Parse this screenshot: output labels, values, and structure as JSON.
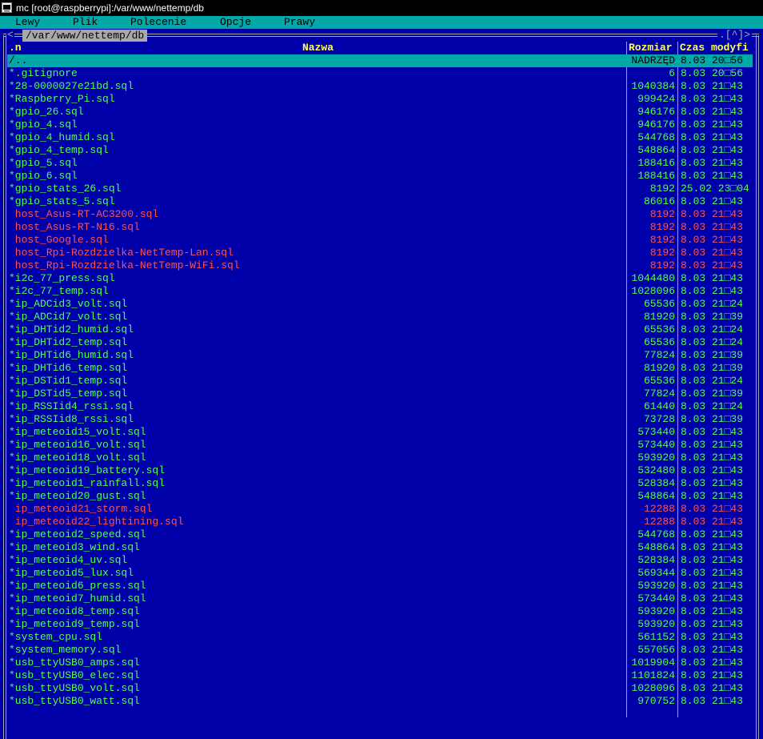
{
  "window": {
    "title": "mc [root@raspberrypi]:/var/www/nettemp/db",
    "icon": "terminal-icon"
  },
  "menu": [
    "Lewy",
    "Plik",
    "Polecenie",
    "Opcje",
    "Prawy"
  ],
  "panel": {
    "path": "/var/www/nettemp/db",
    "left_arrow": "<",
    "right_controls": ".[^]>",
    "headers": {
      "sort": ".n",
      "name": "Nazwa",
      "size": "Rozmiar",
      "time": "Czas modyfi"
    }
  },
  "colors": {
    "background": "#0000a8",
    "executable": "#54fc54",
    "link": "#fc5454",
    "header": "#ffff54",
    "selection": "#00a8a8"
  },
  "files": [
    {
      "name": "/..",
      "size": "NADRZĘD",
      "time": "8.03 20□56",
      "kind": "dir",
      "selected": true
    },
    {
      "name": "*.gitignore",
      "size": "6",
      "time": "8.03 20□56",
      "kind": "exec"
    },
    {
      "name": "*28-0000027e21bd.sql",
      "size": "1040384",
      "time": "8.03 21□43",
      "kind": "exec"
    },
    {
      "name": "*Raspberry_Pi.sql",
      "size": "999424",
      "time": "8.03 21□43",
      "kind": "exec"
    },
    {
      "name": "*gpio_26.sql",
      "size": "946176",
      "time": "8.03 21□43",
      "kind": "exec"
    },
    {
      "name": "*gpio_4.sql",
      "size": "946176",
      "time": "8.03 21□43",
      "kind": "exec"
    },
    {
      "name": "*gpio_4_humid.sql",
      "size": "544768",
      "time": "8.03 21□43",
      "kind": "exec"
    },
    {
      "name": "*gpio_4_temp.sql",
      "size": "548864",
      "time": "8.03 21□43",
      "kind": "exec"
    },
    {
      "name": "*gpio_5.sql",
      "size": "188416",
      "time": "8.03 21□43",
      "kind": "exec"
    },
    {
      "name": "*gpio_6.sql",
      "size": "188416",
      "time": "8.03 21□43",
      "kind": "exec"
    },
    {
      "name": "*gpio_stats_26.sql",
      "size": "8192",
      "time": "25.02 23□04",
      "kind": "exec"
    },
    {
      "name": "*gpio_stats_5.sql",
      "size": "86016",
      "time": "8.03 21□43",
      "kind": "exec"
    },
    {
      "name": " host_Asus-RT-AC3200.sql",
      "size": "8192",
      "time": "8.03 21□43",
      "kind": "lnk"
    },
    {
      "name": " host_Asus-RT-N16.sql",
      "size": "8192",
      "time": "8.03 21□43",
      "kind": "lnk"
    },
    {
      "name": " host_Google.sql",
      "size": "8192",
      "time": "8.03 21□43",
      "kind": "lnk"
    },
    {
      "name": " host_Rpi-Rozdzielka-NetTemp-Lan.sql",
      "size": "8192",
      "time": "8.03 21□43",
      "kind": "lnk"
    },
    {
      "name": " host_Rpi-Rozdzielka-NetTemp-WiFi.sql",
      "size": "8192",
      "time": "8.03 21□43",
      "kind": "lnk"
    },
    {
      "name": "*i2c_77_press.sql",
      "size": "1044480",
      "time": "8.03 21□43",
      "kind": "exec"
    },
    {
      "name": "*i2c_77_temp.sql",
      "size": "1028096",
      "time": "8.03 21□43",
      "kind": "exec"
    },
    {
      "name": "*ip_ADCid3_volt.sql",
      "size": "65536",
      "time": "8.03 21□24",
      "kind": "exec"
    },
    {
      "name": "*ip_ADCid7_volt.sql",
      "size": "81920",
      "time": "8.03 21□39",
      "kind": "exec"
    },
    {
      "name": "*ip_DHTid2_humid.sql",
      "size": "65536",
      "time": "8.03 21□24",
      "kind": "exec"
    },
    {
      "name": "*ip_DHTid2_temp.sql",
      "size": "65536",
      "time": "8.03 21□24",
      "kind": "exec"
    },
    {
      "name": "*ip_DHTid6_humid.sql",
      "size": "77824",
      "time": "8.03 21□39",
      "kind": "exec"
    },
    {
      "name": "*ip_DHTid6_temp.sql",
      "size": "81920",
      "time": "8.03 21□39",
      "kind": "exec"
    },
    {
      "name": "*ip_DSTid1_temp.sql",
      "size": "65536",
      "time": "8.03 21□24",
      "kind": "exec"
    },
    {
      "name": "*ip_DSTid5_temp.sql",
      "size": "77824",
      "time": "8.03 21□39",
      "kind": "exec"
    },
    {
      "name": "*ip_RSSIid4_rssi.sql",
      "size": "61440",
      "time": "8.03 21□24",
      "kind": "exec"
    },
    {
      "name": "*ip_RSSIid8_rssi.sql",
      "size": "73728",
      "time": "8.03 21□39",
      "kind": "exec"
    },
    {
      "name": "*ip_meteoid15_volt.sql",
      "size": "573440",
      "time": "8.03 21□43",
      "kind": "exec"
    },
    {
      "name": "*ip_meteoid16_volt.sql",
      "size": "573440",
      "time": "8.03 21□43",
      "kind": "exec"
    },
    {
      "name": "*ip_meteoid18_volt.sql",
      "size": "593920",
      "time": "8.03 21□43",
      "kind": "exec"
    },
    {
      "name": "*ip_meteoid19_battery.sql",
      "size": "532480",
      "time": "8.03 21□43",
      "kind": "exec"
    },
    {
      "name": "*ip_meteoid1_rainfall.sql",
      "size": "528384",
      "time": "8.03 21□43",
      "kind": "exec"
    },
    {
      "name": "*ip_meteoid20_gust.sql",
      "size": "548864",
      "time": "8.03 21□43",
      "kind": "exec"
    },
    {
      "name": " ip_meteoid21_storm.sql",
      "size": "12288",
      "time": "8.03 21□43",
      "kind": "lnk"
    },
    {
      "name": " ip_meteoid22_lightining.sql",
      "size": "12288",
      "time": "8.03 21□43",
      "kind": "lnk"
    },
    {
      "name": "*ip_meteoid2_speed.sql",
      "size": "544768",
      "time": "8.03 21□43",
      "kind": "exec"
    },
    {
      "name": "*ip_meteoid3_wind.sql",
      "size": "548864",
      "time": "8.03 21□43",
      "kind": "exec"
    },
    {
      "name": "*ip_meteoid4_uv.sql",
      "size": "528384",
      "time": "8.03 21□43",
      "kind": "exec"
    },
    {
      "name": "*ip_meteoid5_lux.sql",
      "size": "569344",
      "time": "8.03 21□43",
      "kind": "exec"
    },
    {
      "name": "*ip_meteoid6_press.sql",
      "size": "593920",
      "time": "8.03 21□43",
      "kind": "exec"
    },
    {
      "name": "*ip_meteoid7_humid.sql",
      "size": "573440",
      "time": "8.03 21□43",
      "kind": "exec"
    },
    {
      "name": "*ip_meteoid8_temp.sql",
      "size": "593920",
      "time": "8.03 21□43",
      "kind": "exec"
    },
    {
      "name": "*ip_meteoid9_temp.sql",
      "size": "593920",
      "time": "8.03 21□43",
      "kind": "exec"
    },
    {
      "name": "*system_cpu.sql",
      "size": "561152",
      "time": "8.03 21□43",
      "kind": "exec"
    },
    {
      "name": "*system_memory.sql",
      "size": "557056",
      "time": "8.03 21□43",
      "kind": "exec"
    },
    {
      "name": "*usb_ttyUSB0_amps.sql",
      "size": "1019904",
      "time": "8.03 21□43",
      "kind": "exec"
    },
    {
      "name": "*usb_ttyUSB0_elec.sql",
      "size": "1101824",
      "time": "8.03 21□43",
      "kind": "exec"
    },
    {
      "name": "*usb_ttyUSB0_volt.sql",
      "size": "1028096",
      "time": "8.03 21□43",
      "kind": "exec"
    },
    {
      "name": "*usb_ttyUSB0_watt.sql",
      "size": "970752",
      "time": "8.03 21□43",
      "kind": "exec"
    }
  ]
}
